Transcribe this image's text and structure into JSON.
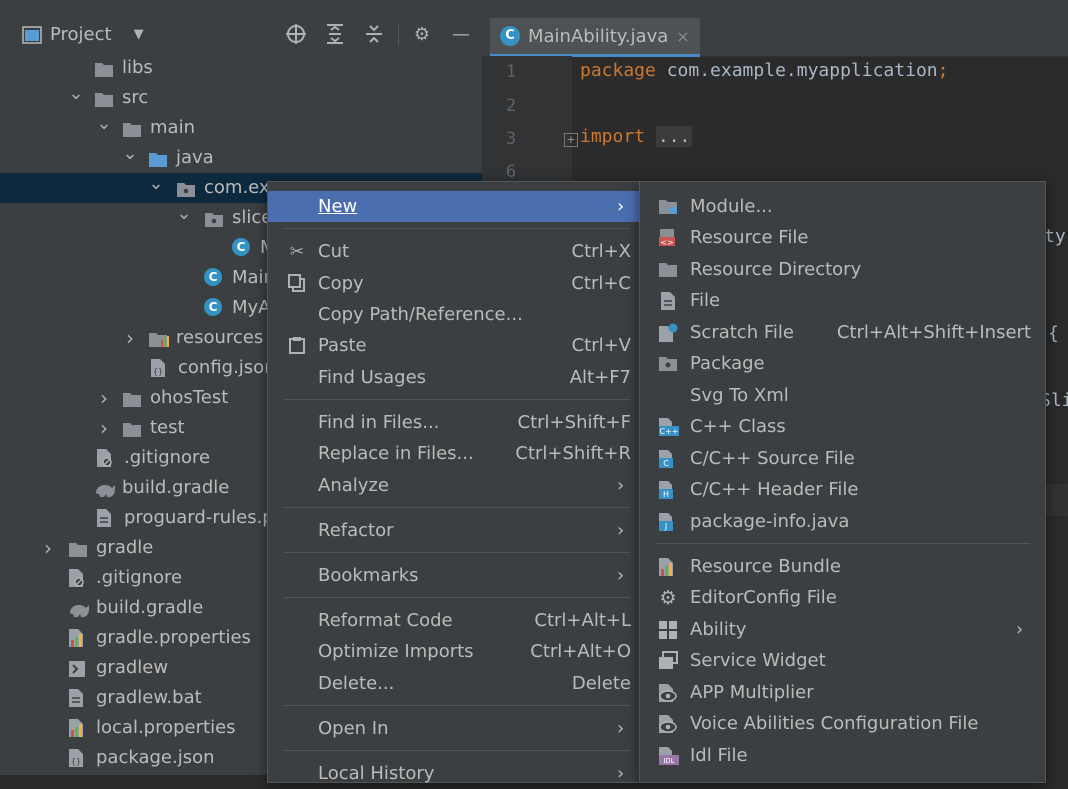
{
  "project_panel": {
    "title": "Project",
    "tree": [
      {
        "label": "libs",
        "kind": "folder"
      },
      {
        "label": "src",
        "kind": "folder",
        "expanded": true
      },
      {
        "label": "main",
        "kind": "folder",
        "expanded": true
      },
      {
        "label": "java",
        "kind": "source-folder",
        "expanded": true
      },
      {
        "label": "com.exa",
        "kind": "package",
        "expanded": true,
        "selected": true
      },
      {
        "label": "slice",
        "kind": "package",
        "expanded": true
      },
      {
        "label": "M",
        "kind": "class"
      },
      {
        "label": "Main",
        "kind": "class"
      },
      {
        "label": "MyA",
        "kind": "class"
      },
      {
        "label": "resources",
        "kind": "resources-folder"
      },
      {
        "label": "config.json",
        "kind": "json-file"
      },
      {
        "label": "ohosTest",
        "kind": "folder"
      },
      {
        "label": "test",
        "kind": "folder"
      },
      {
        "label": ".gitignore",
        "kind": "ignore-file"
      },
      {
        "label": "build.gradle",
        "kind": "gradle-file"
      },
      {
        "label": "proguard-rules.p",
        "kind": "file"
      },
      {
        "label": "gradle",
        "kind": "folder"
      },
      {
        "label": ".gitignore",
        "kind": "ignore-file"
      },
      {
        "label": "build.gradle",
        "kind": "gradle-file"
      },
      {
        "label": "gradle.properties",
        "kind": "properties-file"
      },
      {
        "label": "gradlew",
        "kind": "script-file"
      },
      {
        "label": "gradlew.bat",
        "kind": "file"
      },
      {
        "label": "local.properties",
        "kind": "properties-file"
      },
      {
        "label": "package.json",
        "kind": "json-file"
      }
    ]
  },
  "editor": {
    "tab": {
      "label": "MainAbility.java",
      "close": "×"
    },
    "line_numbers": [
      "1",
      "2",
      "3",
      "6"
    ],
    "line1_keyword": "package",
    "line1_rest": " com.example.myapplication",
    "line1_semi": ";",
    "line3_keyword": "import",
    "line3_fold": "...",
    "fragments": [
      "ty",
      "{",
      "Sli"
    ]
  },
  "context_menu": {
    "items": [
      {
        "label": "New",
        "shortcut": "",
        "submenu": true,
        "icon": ""
      },
      {
        "label": "Cut",
        "shortcut": "Ctrl+X",
        "icon": "scissors-icon"
      },
      {
        "label": "Copy",
        "shortcut": "Ctrl+C",
        "icon": "copy-icon"
      },
      {
        "label": "Copy Path/Reference...",
        "shortcut": ""
      },
      {
        "label": "Paste",
        "shortcut": "Ctrl+V",
        "icon": "paste-icon"
      },
      {
        "label": "Find Usages",
        "shortcut": "Alt+F7"
      },
      {
        "label": "Find in Files...",
        "shortcut": "Ctrl+Shift+F"
      },
      {
        "label": "Replace in Files...",
        "shortcut": "Ctrl+Shift+R"
      },
      {
        "label": "Analyze",
        "submenu": true
      },
      {
        "label": "Refactor",
        "submenu": true
      },
      {
        "label": "Bookmarks",
        "submenu": true
      },
      {
        "label": "Reformat Code",
        "shortcut": "Ctrl+Alt+L"
      },
      {
        "label": "Optimize Imports",
        "shortcut": "Ctrl+Alt+O"
      },
      {
        "label": "Delete...",
        "shortcut": "Delete"
      },
      {
        "label": "Open In",
        "submenu": true
      },
      {
        "label": "Local History",
        "submenu": true
      }
    ]
  },
  "new_submenu": {
    "items": [
      {
        "label": "Module...",
        "icon": "module-icon"
      },
      {
        "label": "Resource File",
        "icon": "resource-file-icon"
      },
      {
        "label": "Resource Directory",
        "icon": "folder-icon"
      },
      {
        "label": "File",
        "icon": "file-icon"
      },
      {
        "label": "Scratch File",
        "shortcut": "Ctrl+Alt+Shift+Insert",
        "icon": "scratch-file-icon"
      },
      {
        "label": "Package",
        "icon": "package-icon"
      },
      {
        "label": "Svg To Xml",
        "icon": ""
      },
      {
        "label": "C++ Class",
        "icon": "cpp-class-icon"
      },
      {
        "label": "C/C++ Source File",
        "icon": "c-source-icon"
      },
      {
        "label": "C/C++ Header File",
        "icon": "c-header-icon"
      },
      {
        "label": "package-info.java",
        "icon": "java-file-icon"
      },
      {
        "label": "Resource Bundle",
        "icon": "resource-bundle-icon"
      },
      {
        "label": "EditorConfig File",
        "icon": "gear-icon"
      },
      {
        "label": "Ability",
        "submenu": true,
        "icon": "ability-icon"
      },
      {
        "label": "Service Widget",
        "icon": "widget-icon"
      },
      {
        "label": "APP Multiplier",
        "icon": "eye-icon"
      },
      {
        "label": "Voice Abilities Configuration File",
        "icon": "eye-icon"
      },
      {
        "label": "Idl File",
        "icon": "idl-icon"
      }
    ]
  },
  "colors": {
    "panel_bg": "#3c3f41",
    "editor_bg": "#2b2b2b",
    "highlight": "#4b6eaf",
    "selection": "#0d293e",
    "keyword": "#cc7832",
    "class_icon": "#3592c4"
  }
}
